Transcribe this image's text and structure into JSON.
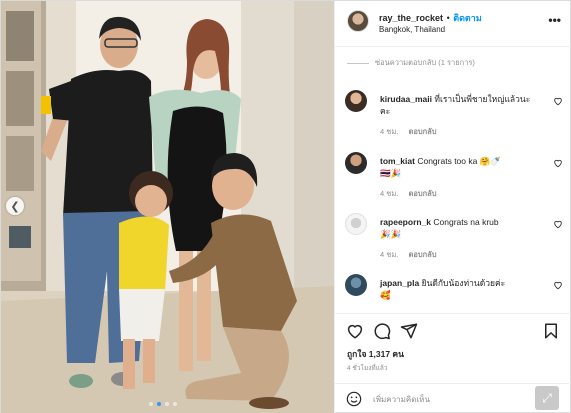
{
  "post": {
    "username": "ray_the_rocket",
    "separator": "•",
    "follow_label": "ติดตาม",
    "location": "Bangkok, Thailand",
    "more_icon": "more-dots-icon"
  },
  "carousel": {
    "prev_icon": "chevron-left-icon",
    "dot_count": 4,
    "active_index": 1
  },
  "hide_replies_label": "ซ่อนความตอบกลับ (1 รายการ)",
  "comments": [
    {
      "user": "kirudaa_maii",
      "text": "ที่เราเป็นพี่ชายใหญ่แล้วนะคะ",
      "time": "4 ชม.",
      "reply_label": "ตอบกลับ"
    },
    {
      "user": "tom_kiat",
      "text": "Congrats too ka 🤗🍼",
      "second_line": "🇹🇭🎉",
      "time": "4 ชม.",
      "reply_label": "ตอบกลับ"
    },
    {
      "user": "rapeeporn_k",
      "text": "Congrats na krub",
      "second_line": "🎉🎉",
      "time": "4 ชม.",
      "reply_label": "ตอบกลับ"
    },
    {
      "user": "japan_pla",
      "text": "ยินดีกับน้องท่านด้วยค่ะ",
      "second_line": "🥰",
      "time": "",
      "reply_label": ""
    }
  ],
  "actions": {
    "like_icon": "heart-icon",
    "comment_icon": "comment-bubble-icon",
    "share_icon": "paper-plane-icon",
    "save_icon": "bookmark-icon"
  },
  "likes_text": "ถูกใจ 1,317 คน",
  "time_ago": "4 ชั่วโมงที่แล้ว",
  "add_comment": {
    "placeholder": "เพิ่มความคิดเห็น",
    "emoji_icon": "smiley-icon",
    "expand_icon": "expand-arrows-icon"
  },
  "colors": {
    "accent": "#0095f6",
    "muted": "#8e8e8e",
    "text": "#262626"
  }
}
